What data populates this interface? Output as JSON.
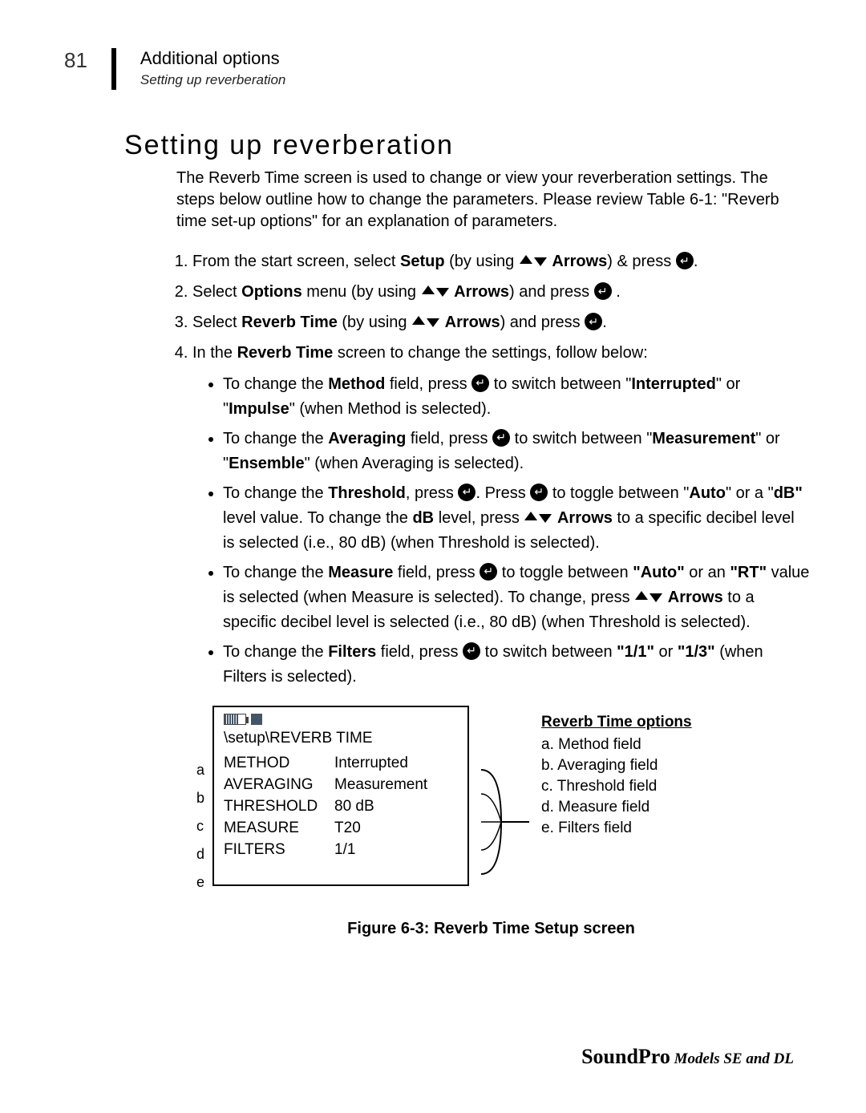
{
  "page_number": "81",
  "header": {
    "title": "Additional options",
    "subtitle": "Setting up reverberation"
  },
  "section_title": "Setting up reverberation",
  "intro": "The Reverb Time screen is used to change or view your reverberation settings. The steps below outline how to change the parameters.  Please review Table 6-1: \"Reverb time set-up options\" for an explanation of parameters.",
  "steps": {
    "s1_a": "From the start screen, select ",
    "s1_b": "Setup",
    "s1_c": " (by using ",
    "s1_d": "Arrows",
    "s1_e": ") & press ",
    "s2_a": "Select ",
    "s2_b": "Options",
    "s2_c": " menu (by using ",
    "s2_d": "Arrows",
    "s2_e": ") and press ",
    "s3_a": "Select ",
    "s3_b": "Reverb Time",
    "s3_c": " (by using ",
    "s3_d": "Arrows",
    "s3_e": ") and press ",
    "s4_a": "In the ",
    "s4_b": "Reverb Time",
    "s4_c": " screen to change the settings, follow below:"
  },
  "bullets": {
    "b1_a": "To change the ",
    "b1_b": "Method",
    "b1_c": " field, press ",
    "b1_d": " to switch between \"",
    "b1_e": "Interrupted",
    "b1_f": "\" or \"",
    "b1_g": "Impulse",
    "b1_h": "\" (when Method is selected).",
    "b2_a": "To change the ",
    "b2_b": "Averaging",
    "b2_c": " field, press ",
    "b2_d": " to switch between \"",
    "b2_e": "Measurement",
    "b2_f": "\" or \"",
    "b2_g": "Ensemble",
    "b2_h": "\" (when Averaging is selected).",
    "b3_a": "To change the ",
    "b3_b": "Threshold",
    "b3_c": ", press ",
    "b3_d": ".  Press ",
    "b3_e": "  to toggle between \"",
    "b3_f": "Auto",
    "b3_g": "\" or a \"",
    "b3_h": "dB\"",
    "b3_i": " level value.  To change the ",
    "b3_j": "dB",
    "b3_k": " level, press ",
    "b3_l": "Arrows",
    "b3_m": " to a specific decibel level is selected (i.e., 80 dB) (when Threshold is selected).",
    "b4_a": "To change the ",
    "b4_b": "Measure",
    "b4_c": " field, press ",
    "b4_d": " to toggle between ",
    "b4_e": "\"Auto\"",
    "b4_f": " or an ",
    "b4_g": "\"RT\"",
    "b4_h": " value is selected (when Measure is selected).  To change, press ",
    "b4_i": "Arrows",
    "b4_j": " to a specific decibel level is selected (i.e., 80 dB) (when Threshold is selected).",
    "b5_a": "To change the ",
    "b5_b": "Filters",
    "b5_c": " field, press ",
    "b5_d": " to switch between ",
    "b5_e": "\"1/1\"",
    "b5_f": " or ",
    "b5_g": "\"1/3\"",
    "b5_h": " (when Filters is selected)."
  },
  "screen": {
    "path": "\\setup\\REVERB TIME",
    "labels": [
      "a",
      "b",
      "c",
      "d",
      "e"
    ],
    "rows": [
      {
        "k": "METHOD",
        "v": "Interrupted"
      },
      {
        "k": "AVERAGING",
        "v": "Measurement"
      },
      {
        "k": "THRESHOLD",
        "v": "80 dB"
      },
      {
        "k": "MEASURE",
        "v": "T20"
      },
      {
        "k": "FILTERS",
        "v": "1/1"
      }
    ]
  },
  "legend": {
    "title": "Reverb Time options",
    "items": [
      "a.  Method field",
      "b.  Averaging field",
      "c.  Threshold field",
      "d.  Measure field",
      "e.  Filters field"
    ]
  },
  "figure_caption": "Figure 6-3:  Reverb Time Setup screen",
  "footer": {
    "brand": "SoundPro",
    "models": "  Models SE and DL"
  }
}
